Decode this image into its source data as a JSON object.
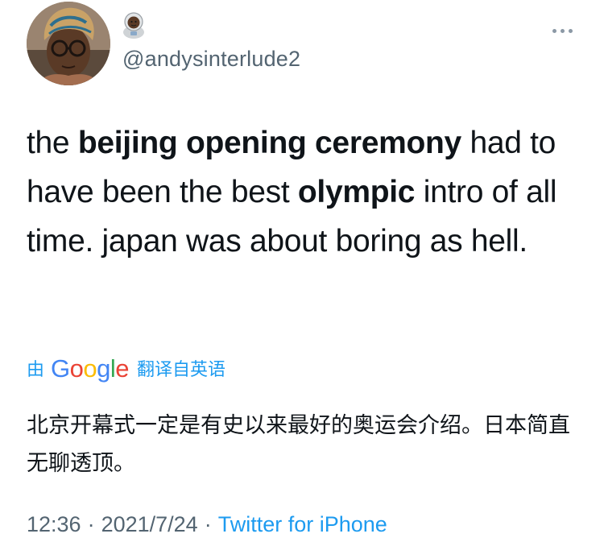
{
  "author": {
    "handle": "@andysinterlude2",
    "emoji": "astronaut-emoji"
  },
  "tweet": {
    "segments": [
      {
        "text": "the ",
        "bold": false
      },
      {
        "text": "beijing opening ceremony",
        "bold": true
      },
      {
        "text": " had to have been the best ",
        "bold": false
      },
      {
        "text": "olympic",
        "bold": true
      },
      {
        "text": " intro of all time. japan was about boring as hell.",
        "bold": false
      }
    ]
  },
  "translation": {
    "by_label": "由",
    "provider": "Google",
    "label": "翻译自英语",
    "text": "北京开幕式一定是有史以来最好的奥运会介绍。日本简直无聊透顶。"
  },
  "meta": {
    "time": "12:36",
    "separator": "·",
    "date": "2021/7/24",
    "source": "Twitter for iPhone"
  },
  "colors": {
    "text": "#0f1419",
    "secondary": "#536471",
    "link": "#1d9bf0"
  }
}
